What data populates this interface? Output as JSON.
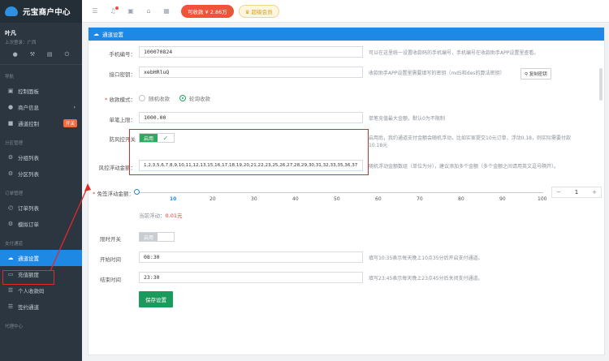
{
  "brand": {
    "title": "元宝商户中心"
  },
  "user": {
    "name": "叶凡",
    "last_login": "上次登录：广西"
  },
  "quick_icons": [
    "user-icon",
    "wrench-icon",
    "server-icon",
    "power-icon"
  ],
  "sidebar": {
    "sections": [
      {
        "title": "导航",
        "items": [
          {
            "label": "控制面板",
            "icon": "dashboard-icon"
          },
          {
            "label": "商户信息",
            "icon": "user-icon",
            "arrow": "›"
          },
          {
            "label": "通道控制",
            "icon": "channel-icon",
            "badge": "开关"
          }
        ]
      },
      {
        "title": "分区管理",
        "items": [
          {
            "label": "分组列表",
            "icon": "gear-icon"
          },
          {
            "label": "分区列表",
            "icon": "gear-icon"
          }
        ]
      },
      {
        "title": "订单管理",
        "items": [
          {
            "label": "订单列表",
            "icon": "clock-icon"
          },
          {
            "label": "模拟订单",
            "icon": "gear-icon"
          }
        ]
      },
      {
        "title": "支付通道",
        "items": [
          {
            "label": "通道设置",
            "icon": "cloud-icon",
            "active": true
          },
          {
            "label": "充值额度",
            "icon": "card-icon"
          },
          {
            "label": "个人收款码",
            "icon": "list-icon"
          },
          {
            "label": "签约通道",
            "icon": "list-icon"
          }
        ]
      },
      {
        "title": "代理中心",
        "items": []
      }
    ]
  },
  "topbar": {
    "balance": "可收款 ¥ 2.86万",
    "vip": "超级会员"
  },
  "panel": {
    "title": "通道设置",
    "phone": {
      "label": "手机编号：",
      "value": "100070824",
      "hint": "可以在这里统一设置收款码的手机编号，手机编号在收款助手APP设置里查看。"
    },
    "key": {
      "label": "接口密钥：",
      "value": "xebHRluQ",
      "hint": "收款助手APP设置里需要填写的密钥（md5和des的算法密钥）",
      "copy": "复制密钥"
    },
    "mode": {
      "label": "收款模式：",
      "options": [
        "随机收款",
        "轮询收款"
      ],
      "selected": 1
    },
    "limit": {
      "label": "单笔上限：",
      "value": "1000.00",
      "hint": "单笔充值最大金额，默认0为不限制"
    },
    "risk_switch": {
      "label": "防风控开关",
      "on_text": "启用",
      "hint": "启用后，我约通道支付金额会随机浮动，比如实家提交10元订单，浮动0.18，则实际需要付款10.18元"
    },
    "risk_amount": {
      "label": "风控浮动金额：",
      "value": "1,2,3,5,6,7,8,9,10,11,12,13,15,16,17,18,19,20,21,22,23,25,26,27,28,29,30,31,32,33,35,36,37",
      "hint": "随机浮动金额数组（单位为分），建议添加多个金额（多个金额之间请用英文逗号隔开）。"
    },
    "free_float": {
      "label": "免签浮动金额：",
      "ticks": [
        "10",
        "20",
        "30",
        "40",
        "50",
        "60",
        "70",
        "80",
        "90",
        "100"
      ],
      "value": "1",
      "current_label": "当前浮动：",
      "current_value": "0.01元"
    },
    "time_switch": {
      "label": "限时开关",
      "off_text": "启用"
    },
    "start": {
      "label": "开始时间",
      "value": "08:30",
      "hint": "填写10:35表示每天晚上10点35分后开启支付通道。"
    },
    "end": {
      "label": "结束时间",
      "value": "23:30",
      "hint": "填写23:45表示每天晚上23点45分后关闭支付通道。"
    },
    "save": "保存设置"
  }
}
